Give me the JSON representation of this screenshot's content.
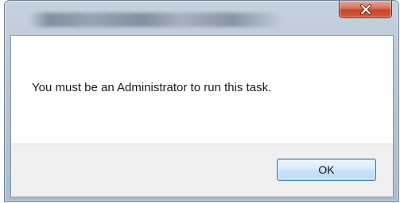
{
  "dialog": {
    "message": "You must be an Administrator to run this task.",
    "ok_label": "OK",
    "close_icon": "close-icon"
  },
  "colors": {
    "close_button": "#c7442a",
    "ok_button_border": "#3c7fb1",
    "frame": "#bac8d6",
    "button_strip": "#f0f0f0"
  }
}
